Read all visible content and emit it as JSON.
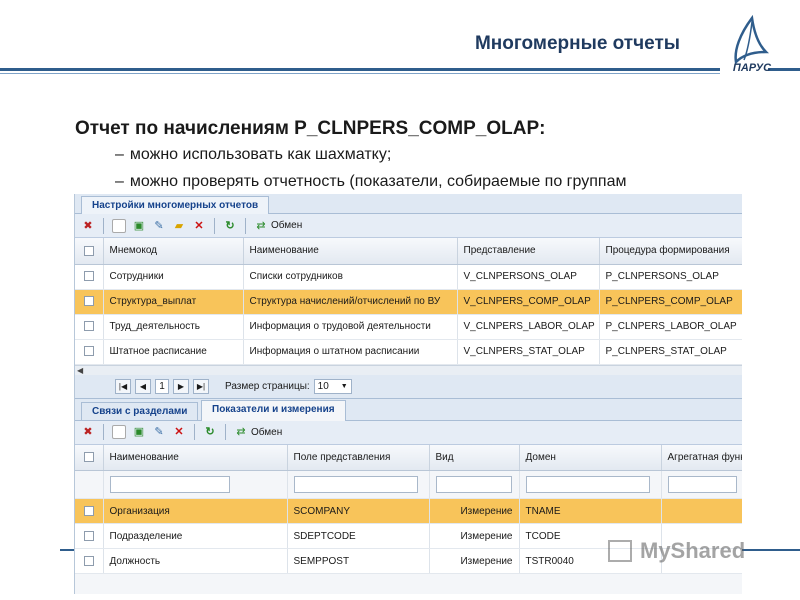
{
  "slide": {
    "title": "Многомерные отчеты",
    "logo_text": "ПАРУС",
    "heading": "Отчет по начислениям P_CLNPERS_COMP_OLAP:",
    "bullets": [
      "можно использовать как шахматку;",
      "можно проверять отчетность (показатели, собираемые по группам"
    ],
    "dash": "–"
  },
  "colors": {
    "accent": "#2f5d8c",
    "selected_row": "#f8c45a",
    "grid_header": "#e3e9f1"
  },
  "app": {
    "top_tab": "Настройки многомерных отчетов",
    "toolbar1": {
      "exchange_label": "Обмен"
    },
    "grid1": {
      "columns": [
        "Мнемокод",
        "Наименование",
        "Представление",
        "Процедура формирования"
      ],
      "rows": [
        [
          "Сотрудники",
          "Списки сотрудников",
          "V_CLNPERSONS_OLAP",
          "P_CLNPERSONS_OLAP"
        ],
        [
          "Структура_выплат",
          "Структура начислений/отчислений по ВУ",
          "V_CLNPERS_COMP_OLAP",
          "P_CLNPERS_COMP_OLAP"
        ],
        [
          "Труд_деятельность",
          "Информация о трудовой деятельности",
          "V_CLNPERS_LABOR_OLAP",
          "P_CLNPERS_LABOR_OLAP"
        ],
        [
          "Штатное расписание",
          "Информация о штатном расписании",
          "V_CLNPERS_STAT_OLAP",
          "P_CLNPERS_STAT_OLAP"
        ]
      ],
      "selected_row": 1
    },
    "pager": {
      "page": "1",
      "page_size_label": "Размер страницы:",
      "page_size": "10"
    },
    "bottom_tabs": [
      "Связи с разделами",
      "Показатели и измерения"
    ],
    "toolbar2": {
      "exchange_label": "Обмен"
    },
    "grid2": {
      "columns": [
        "Наименование",
        "Поле представления",
        "Вид",
        "Домен",
        "Агрегатная функ"
      ],
      "rows": [
        [
          "Организация",
          "SCOMPANY",
          "Измерение",
          "TNAME",
          ""
        ],
        [
          "Подразделение",
          "SDEPTCODE",
          "Измерение",
          "TCODE",
          ""
        ],
        [
          "Должность",
          "SEMPPOST",
          "Измерение",
          "TSTR0040",
          ""
        ]
      ],
      "selected_row": 0
    },
    "icons": [
      "delete-config-icon",
      "new-icon",
      "add-icon",
      "edit-icon",
      "folder-icon",
      "delete-icon",
      "refresh-icon",
      "exchange-icon"
    ]
  },
  "watermark": "MyShared"
}
